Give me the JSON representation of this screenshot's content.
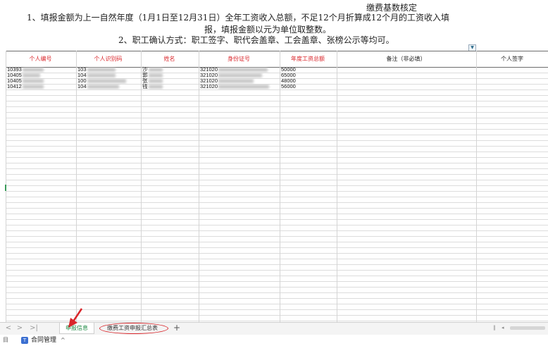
{
  "notes": {
    "title": "缴费基数核定",
    "line1": "1、填报金额为上一自然年度（1月1日至12月31日）全年工资收入总额，不足12个月折算成12个月的工资收入填",
    "line2": "报，填报金额以元为单位取整数。",
    "line3": "2、职工确认方式：职工签字、职代会盖章、工会盖章、张榜公示等均可。"
  },
  "table": {
    "headers": [
      "个人编号",
      "个人识别码",
      "姓名",
      "身份证号",
      "年度工资总额",
      "备注（非必填）",
      "个人签字"
    ],
    "rows": [
      {
        "id": "10393",
        "code": "103",
        "name": "沙",
        "idcard": "321020",
        "salary": "50000"
      },
      {
        "id": "10405",
        "code": "104",
        "name": "郭",
        "idcard": "321020",
        "salary": "65000"
      },
      {
        "id": "10405",
        "code": "100",
        "name": "张",
        "idcard": "321020",
        "salary": "48000"
      },
      {
        "id": "10412",
        "code": "104",
        "name": "钱",
        "idcard": "321020",
        "salary": "56000"
      }
    ],
    "filter_icon": "filter-dropdown-icon"
  },
  "sheet_tabs": {
    "nav": [
      "<",
      ">",
      ">|"
    ],
    "tabs": [
      {
        "label": "申报信息",
        "active": true
      },
      {
        "label": "缴费工资申报汇总表",
        "active": false
      }
    ],
    "add": "+"
  },
  "statusbar": {
    "left": "目",
    "item": "合同管理",
    "caret": "^"
  },
  "colors": {
    "header_red": "#d9252a",
    "active_tab_green": "#1e8a44",
    "annotation_red": "#d9252a"
  }
}
